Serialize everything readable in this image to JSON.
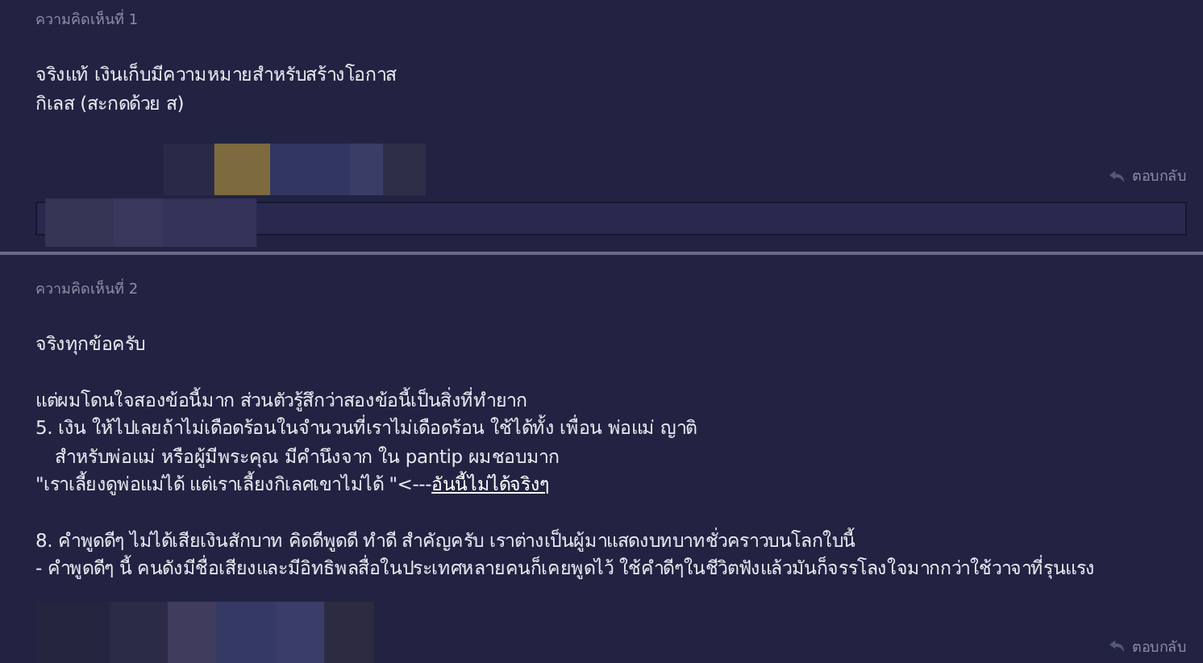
{
  "comments": [
    {
      "label": "ความคิดเห็นที่ 1",
      "paragraphs": [
        [
          {
            "text": "จริงแท้ เงินเก็บมีความหมายสำหรับสร้างโอกาส"
          },
          {
            "text": "กิเลส (สะกดด้วย ส)"
          }
        ]
      ],
      "reply": "ตอบกลับ",
      "reply_field": true
    },
    {
      "label": "ความคิดเห็นที่ 2",
      "paragraphs": [
        [
          {
            "text": "จริงทุกข้อครับ"
          }
        ],
        [
          {
            "text": "แต่ผมโดนใจสองข้อนี้มาก ส่วนตัวรู้สึกว่าสองข้อนี้เป็นสิ่งที่ทำยาก"
          },
          {
            "text": "5. เงิน ให้ไปเลยถ้าไม่เดือดร้อนในจำนวนที่เราไม่เดือดร้อน ใช้ได้ทั้ง เพื่อน พ่อแม่ ญาติ"
          },
          {
            "text": "สำหรับพ่อแม่ หรือผู้มีพระคุณ มีคำนึงจาก ใน pantip ผมชอบมาก",
            "indent": true
          },
          {
            "text": "\"เราเลี้ยงดูพ่อแม่ได้ แต่เราเลี้ยงกิเลศเขาไม่ได้ \"<---",
            "link": "อันนี้ไม่ได้จริงๆ"
          }
        ],
        [
          {
            "text": "8. คำพูดดีๆ ไม่ได้เสียเงินสักบาท คิดดีพูดดี ทำดี สำคัญครับ เราต่างเป็นผู้มาแสดงบทบาทชั่วคราวบนโลกใบนี้"
          },
          {
            "text": "- คำพูดดีๆ นี้ คนดังมีชื่อเสียงและมีอิทธิพลสื่อในประเทศหลายคนก็เคยพูดไว้ ใช้คำดีๆในชีวิตฟังแล้วมันก็จรรโลงใจมากกว่าใช้วาจาที่รุนแรง"
          }
        ]
      ],
      "reply": "ตอบกลับ"
    }
  ]
}
